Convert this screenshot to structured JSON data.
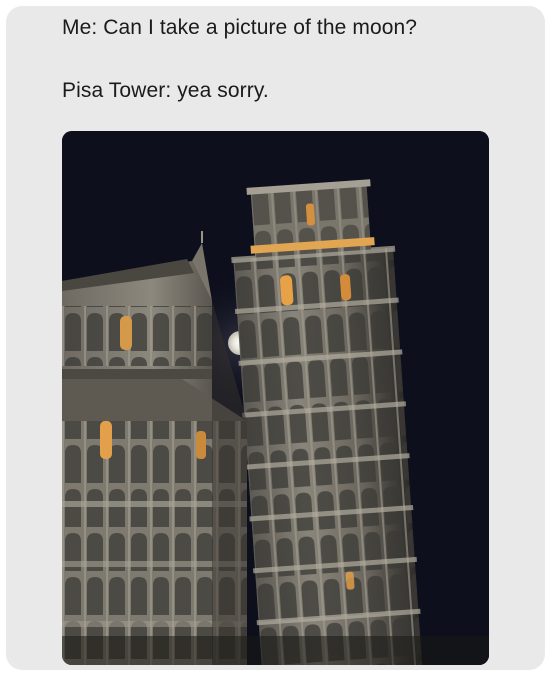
{
  "post": {
    "line1": "Me: Can I take a picture of the moon?",
    "line2": "Pisa Tower: yea sorry."
  },
  "photo": {
    "subject": "night-photo-leaning-tower-moon"
  },
  "colors": {
    "card_bg": "#e9e9ea",
    "text": "#1b1b1b",
    "sky": "#0d0f1c",
    "marble_light": "#8f8a80",
    "marble_dark": "#3c3a35",
    "window_glow": "#e7a248",
    "moon": "#f3f1ea"
  }
}
